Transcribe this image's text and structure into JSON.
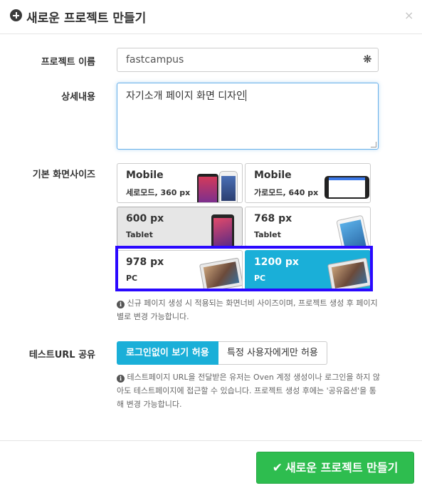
{
  "header": {
    "title": "새로운 프로젝트 만들기",
    "close_symbol": "×"
  },
  "form": {
    "name_label": "프로젝트 이름",
    "name_value": "fastcampus",
    "required_symbol": "❋",
    "desc_label": "상세내용",
    "desc_value": "자기소개 페이지 화면 디자인",
    "size_label": "기본 화면사이즈",
    "sizes": [
      {
        "title": "Mobile",
        "sub": "세로모드, 360 px",
        "icon": "portrait-phones-icon"
      },
      {
        "title": "Mobile",
        "sub": "가로모드, 640 px",
        "icon": "landscape-phone-icon"
      },
      {
        "title": "600 px",
        "sub": "Tablet",
        "icon": "small-tablet-icon"
      },
      {
        "title": "768 px",
        "sub": "Tablet",
        "icon": "ipad-icon"
      },
      {
        "title": "978 px",
        "sub": "PC",
        "icon": "laptop-icon"
      },
      {
        "title": "1200 px",
        "sub": "PC",
        "icon": "laptop-icon"
      }
    ],
    "size_help": "신규 페이지 생성 시 적용되는 화면너비 사이즈이며, 프로젝트 생성 후 페이지 별로 변경 가능합니다.",
    "share_label": "테스트URL 공유",
    "share_options": [
      "로그인없이 보기 허용",
      "특정 사용자에게만 허용"
    ],
    "share_help": "테스트페이지 URL을 전달받은 유저는 Oven 계정 생성이나 로그인을 하지 않아도 테스트페이지에 접근할 수 있습니다. 프로젝트 생성 후에는 '공유옵션'을 통해 변경 가능합니다."
  },
  "footer": {
    "create_label": "새로운 프로젝트 만들기",
    "check_symbol": "✔"
  },
  "colors": {
    "accent": "#1aafd8",
    "create": "#2ebd4f",
    "highlight": "#2a08ff"
  }
}
